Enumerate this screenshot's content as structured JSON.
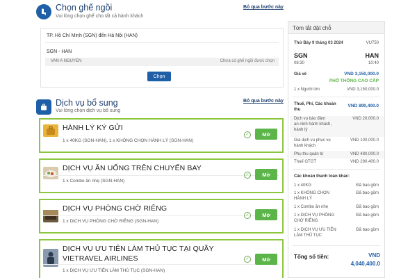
{
  "seat": {
    "title": "Chọn ghế ngồi",
    "subtitle": "Vui lòng chọn ghế cho tất cả hành khách",
    "skip": "Bỏ qua bước này",
    "route": "TP. Hồ Chí Minh (SGN) đến Hà Nội (HAN)",
    "segment": "SGN - HAN",
    "passenger": "VAN A NGUYEN",
    "seat_status": "Chưa có ghế ngồi được chọn",
    "choose_button": "Chọn"
  },
  "services": {
    "title": "Dịch vụ bổ sung",
    "subtitle": "Vui lòng chọn dịch vụ bổ sung",
    "skip": "Bỏ qua bước này",
    "items": [
      {
        "title": "HÀNH LÝ KÝ GỬI",
        "desc": "1 x 40KG (SGN-HAN), 1 x KHÔNG CHỌN HÀNH LÝ (SGN-HAN)",
        "button": "Mở"
      },
      {
        "title": "DỊCH VỤ ĂN UỐNG TRÊN CHUYẾN BAY",
        "desc": "1 x Combo ăn nhẹ (SGN-HAN)",
        "button": "Mở"
      },
      {
        "title": "DỊCH VỤ PHÒNG CHỜ RIÊNG",
        "desc": "1 x DỊCH VỤ PHÒNG CHỜ RIÊNG (SGN-HAN)",
        "button": "Mở"
      },
      {
        "title": "DỊCH VỤ ƯU TIÊN LÀM THỦ TỤC TẠI QUẦY VIETRAVEL AIRLINES",
        "desc": "1 x DỊCH VỤ ƯU TIÊN LÀM THỦ TỤC (SGN-HAN)",
        "button": "Mở"
      }
    ]
  },
  "summary": {
    "title": "Tóm tắt đặt chỗ",
    "date": "Thứ Bảy 9 tháng 03 2024",
    "flight_no": "VU750",
    "from": "SGN",
    "to": "HAN",
    "dep_time": "08:30",
    "arr_time": "10:40",
    "fare_label": "Giá vé",
    "fare_value": "VND 3,150,000.0",
    "fare_class": "PHỔ THÔNG CAO CẤP",
    "adult_label": "1 x Người lớn",
    "adult_value": "VND 3,150,000.0",
    "taxes_label_1": "Thuế, Phí, Các khoản",
    "taxes_label_2": "thu",
    "taxes_value": "VND 890,400.0",
    "fee_rows": [
      {
        "l1": "Dịch vụ bảo đảm",
        "l2": "an ninh hành khách,",
        "l3": "hành lý",
        "v": "VND 20,000.0"
      },
      {
        "l1": "Giá dịch vụ phục vụ",
        "l2": "hành khách",
        "l3": "",
        "v": "VND 100,000.0"
      },
      {
        "l1": "Phụ thu quản trị",
        "l2": "",
        "l3": "",
        "v": "VND 480,000.0"
      },
      {
        "l1": "Thuế GTGT",
        "l2": "",
        "l3": "",
        "v": "VND 290,400.0"
      }
    ],
    "other_label": "Các khoản thanh toán khác:",
    "other_rows": [
      {
        "l1": "1 x 40KG",
        "l2": "",
        "v": "Đã bao gồm"
      },
      {
        "l1": "1 x KHÔNG CHỌN",
        "l2": "HÀNH LÝ",
        "v": "Đã bao gồm"
      },
      {
        "l1": "1 x Combo ăn nhẹ",
        "l2": "",
        "v": "Đã bao gồm"
      },
      {
        "l1": "1 x DỊCH VỤ PHÒNG",
        "l2": "CHỜ RIÊNG",
        "v": "Đã bao gồm"
      },
      {
        "l1": "1 x DỊCH VỤ ƯU TIÊN",
        "l2": "LÀM THỦ TỤC",
        "v": "Đã bao gồm"
      }
    ],
    "total_label": "Tổng số tiền:",
    "total_currency": "VND",
    "total_value": "4,040,400.0"
  },
  "icons": {
    "seat": "seat-icon",
    "luggage": "luggage-icon",
    "check": "check-circle-icon"
  },
  "colors": {
    "brand": "#1f5fa8",
    "accent_green": "#5bb548",
    "card_border": "#8cc63f"
  }
}
